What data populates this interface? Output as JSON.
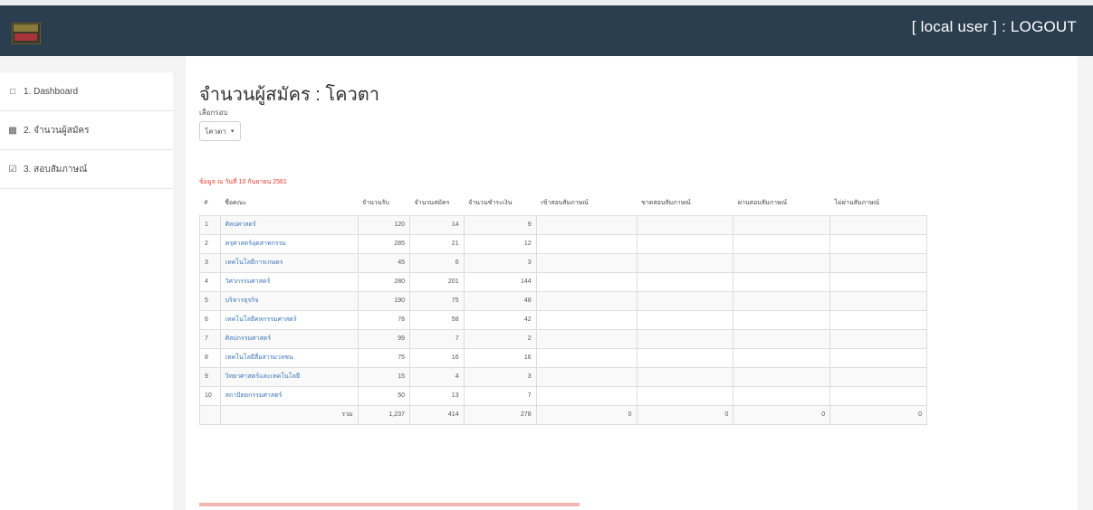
{
  "header": {
    "user_logout": "[ local user ] : LOGOUT"
  },
  "sidebar": {
    "items": [
      {
        "label": "1. Dashboard",
        "icon": "monitor-icon"
      },
      {
        "label": "2. จำนวนผู้สมัคร",
        "icon": "bar-chart-icon"
      },
      {
        "label": "3. สอบสัมภาษณ์",
        "icon": "checkbox-icon"
      }
    ]
  },
  "main": {
    "title": "จำนวนผู้สมัคร : โควตา",
    "filter_label": "เลือกรอบ",
    "filter_value": "โควตา",
    "note": "ข้อมูล ณ วันที่ 10 กันยายน 2561",
    "table": {
      "headers": [
        "#",
        "ชื่อคณะ",
        "จำนวนรับ",
        "จำนวนสมัคร",
        "จำนวนชำระเงิน",
        "เข้าสอบสัมภาษณ์",
        "ขาดสอบสัมภาษณ์",
        "ผ่านสอบสัมภาษณ์",
        "ไม่ผ่านสัมภาษณ์"
      ],
      "rows": [
        [
          "1",
          "ศิลปศาสตร์",
          "120",
          "14",
          "9",
          "",
          "",
          "",
          ""
        ],
        [
          "2",
          "ครุศาสตร์อุตสาหกรรม",
          "285",
          "21",
          "12",
          "",
          "",
          "",
          ""
        ],
        [
          "3",
          "เทคโนโลยีการเกษตร",
          "45",
          "6",
          "3",
          "",
          "",
          "",
          ""
        ],
        [
          "4",
          "วิศวกรรมศาสตร์",
          "280",
          "201",
          "144",
          "",
          "",
          "",
          ""
        ],
        [
          "5",
          "บริหารธุรกิจ",
          "190",
          "75",
          "48",
          "",
          "",
          "",
          ""
        ],
        [
          "6",
          "เทคโนโลยีคหกรรมศาสตร์",
          "78",
          "58",
          "42",
          "",
          "",
          "",
          ""
        ],
        [
          "7",
          "ศิลปกรรมศาสตร์",
          "99",
          "7",
          "2",
          "",
          "",
          "",
          ""
        ],
        [
          "8",
          "เทคโนโลยีสื่อสารมวลชน",
          "75",
          "16",
          "16",
          "",
          "",
          "",
          ""
        ],
        [
          "9",
          "วิทยาศาสตร์และเทคโนโลยี",
          "15",
          "4",
          "3",
          "",
          "",
          "",
          ""
        ],
        [
          "10",
          "สถาปัตยกรรมศาสตร์",
          "50",
          "13",
          "7",
          "",
          "",
          "",
          ""
        ]
      ],
      "total": [
        "รวม",
        "1,237",
        "414",
        "278",
        "0",
        "0",
        "0",
        "0"
      ]
    }
  }
}
